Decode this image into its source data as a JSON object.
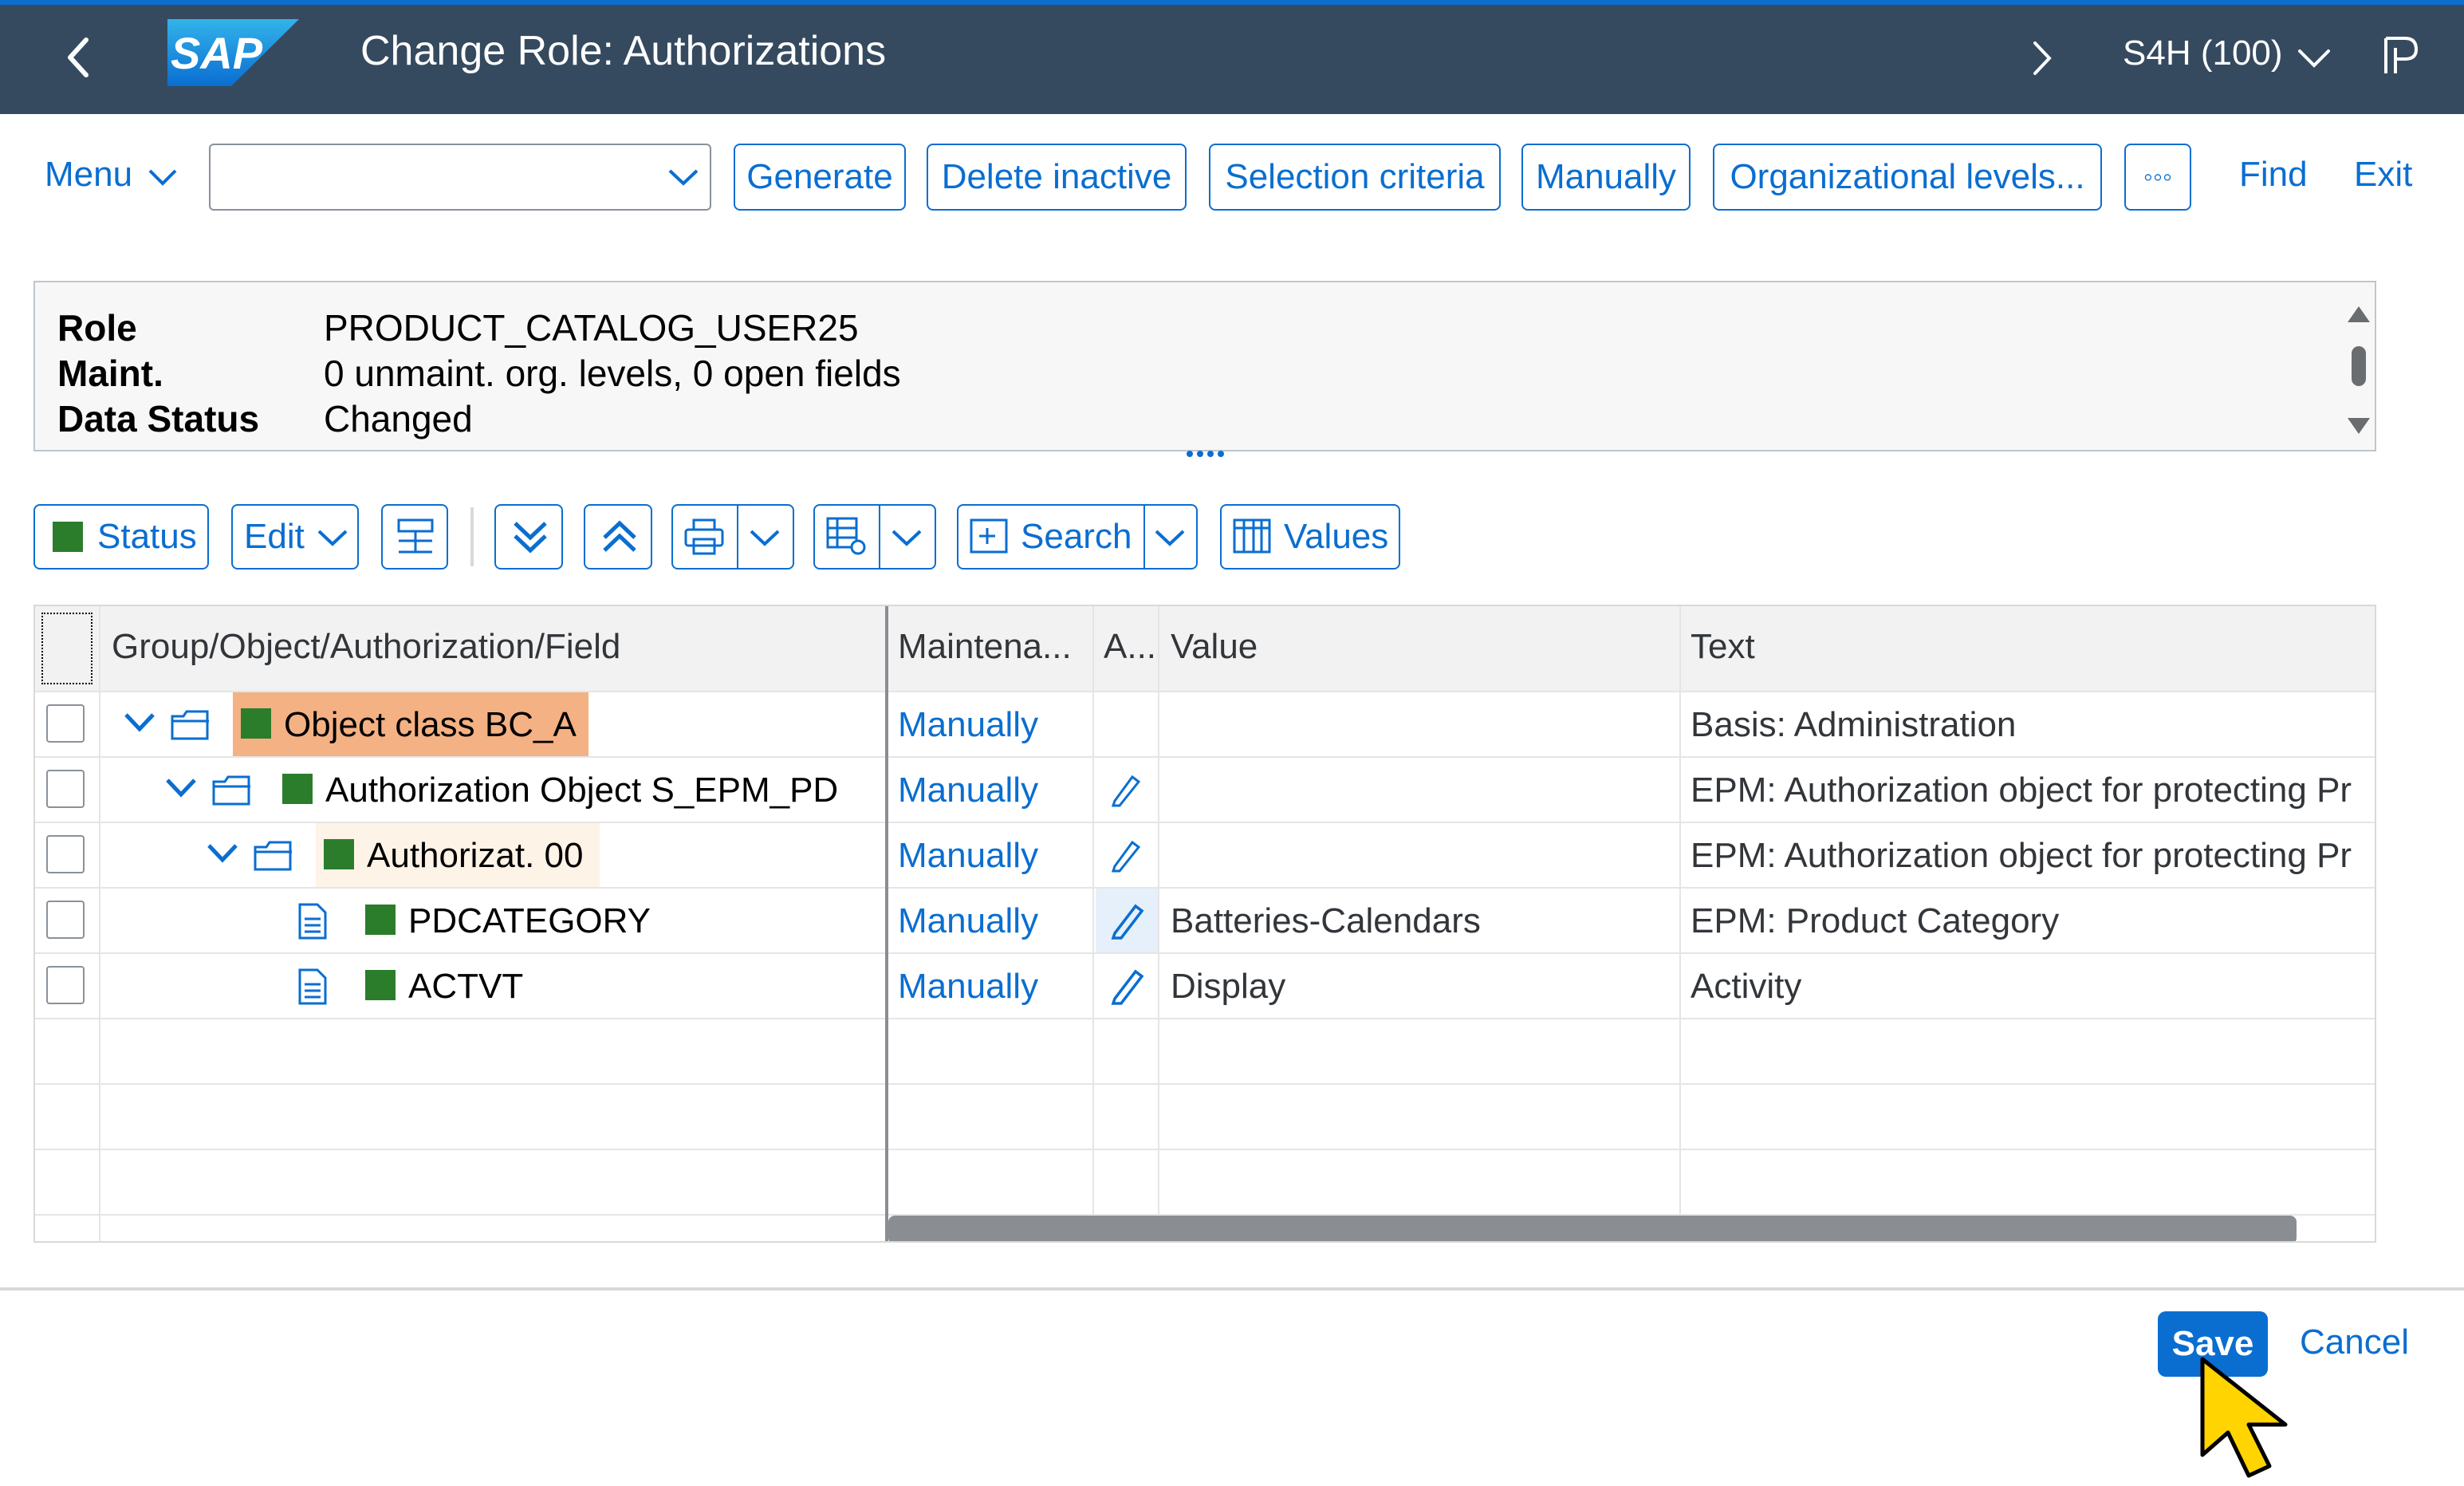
{
  "shell": {
    "logo_text": "SAP",
    "title": "Change Role: Authorizations",
    "system": "S4H (100)",
    "icons": [
      "back-arrow-icon",
      "chevron-right-icon",
      "chevron-down-icon",
      "personalization-icon"
    ]
  },
  "toolbar": {
    "menu": "Menu",
    "command_value": "",
    "buttons": {
      "generate": "Generate",
      "delete_inactive": "Delete inactive",
      "selection_criteria": "Selection criteria",
      "manually": "Manually",
      "org_levels": "Organizational levels...",
      "more": "◦◦◦"
    },
    "find": "Find",
    "exit": "Exit"
  },
  "header_info": {
    "rows": [
      {
        "label": "Role",
        "value": "PRODUCT_CATALOG_USER25"
      },
      {
        "label": "Maint.",
        "value": "0 unmaint. org. levels, 0 open fields"
      },
      {
        "label": "Data Status",
        "value": "Changed"
      }
    ]
  },
  "alv_toolbar": {
    "status": "Status",
    "edit": "Edit",
    "search": "Search",
    "values": "Values"
  },
  "grid": {
    "columns": {
      "node": "Group/Object/Authorization/Field",
      "maintenance": "Maintena...",
      "a": "A...",
      "value": "Value",
      "text": "Text"
    },
    "rows": [
      {
        "node": "Object class BC_A",
        "maintenance": "Manually",
        "value": "",
        "text": "Basis: Administration"
      },
      {
        "node": "Authorization Object S_EPM_PD",
        "maintenance": "Manually",
        "value": "",
        "text": "EPM: Authorization object for protecting Pr"
      },
      {
        "node": "Authorizat. 00",
        "maintenance": "Manually",
        "value": "",
        "text": "EPM: Authorization object for protecting Pr"
      },
      {
        "node": "PDCATEGORY",
        "maintenance": "Manually",
        "value": "Batteries-Calendars",
        "text": "EPM: Product Category"
      },
      {
        "node": "ACTVT",
        "maintenance": "Manually",
        "value": "Display",
        "text": "Activity"
      }
    ]
  },
  "footer": {
    "save": "Save",
    "cancel": "Cancel"
  },
  "colors": {
    "shell": "#354a5f",
    "accent": "#0a6ed1",
    "status_green": "#2b7d2b",
    "highlight_orange": "#f4b183",
    "highlight_light": "#fdf3e6",
    "cursor": "#ffd400"
  }
}
